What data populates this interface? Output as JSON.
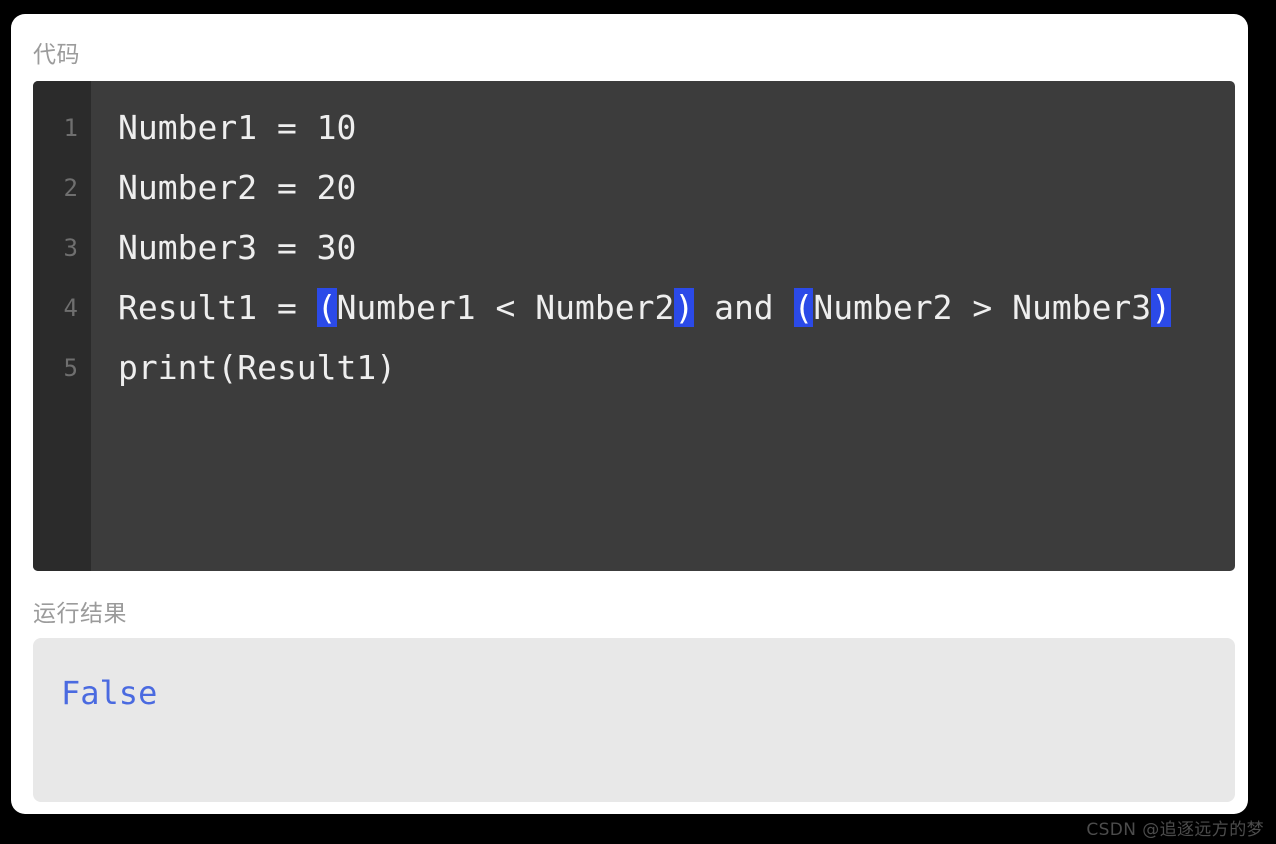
{
  "card": {
    "code_section": {
      "label": "代码",
      "line_numbers": [
        "1",
        "2",
        "3",
        "4",
        "5"
      ],
      "lines": [
        {
          "number": "1",
          "text": "Number1 = 10",
          "tokens": [
            {
              "text": "Number1 = 10",
              "highlight": false
            }
          ]
        },
        {
          "number": "2",
          "text": "Number2 = 20",
          "tokens": [
            {
              "text": "Number2 = 20",
              "highlight": false
            }
          ]
        },
        {
          "number": "3",
          "text": "Number3 = 30",
          "tokens": [
            {
              "text": "Number3 = 30",
              "highlight": false
            }
          ]
        },
        {
          "number": "4",
          "text": "Result1 = (Number1 < Number2) and (Number2 > Number3)",
          "tokens": [
            {
              "text": "Result1 = ",
              "highlight": false
            },
            {
              "text": "(",
              "highlight": true
            },
            {
              "text": "Number1 < Number2",
              "highlight": false
            },
            {
              "text": ")",
              "highlight": true
            },
            {
              "text": " and ",
              "highlight": false
            },
            {
              "text": "(",
              "highlight": true
            },
            {
              "text": "Number2 > Number3",
              "highlight": false
            },
            {
              "text": ")",
              "highlight": true
            }
          ]
        },
        {
          "number": "5",
          "text": "print(Result1)",
          "tokens": [
            {
              "text": "print(Result1)",
              "highlight": false
            }
          ]
        }
      ]
    },
    "output_section": {
      "label": "运行结果",
      "lines": [
        "False"
      ]
    }
  },
  "watermark": {
    "text": "CSDN @追逐远方的梦"
  },
  "colors": {
    "page_background": "#000000",
    "card_background": "#ffffff",
    "code_background": "#3c3c3c",
    "gutter_background": "#2b2b2b",
    "code_text": "#eeeeee",
    "line_number_text": "#6f6f6f",
    "bracket_highlight": "#2b4ae8",
    "output_background": "#e8e8e8",
    "output_text": "#4a6ae0",
    "label_text": "#9b9b9b",
    "watermark_text": "#4c4c4c"
  }
}
